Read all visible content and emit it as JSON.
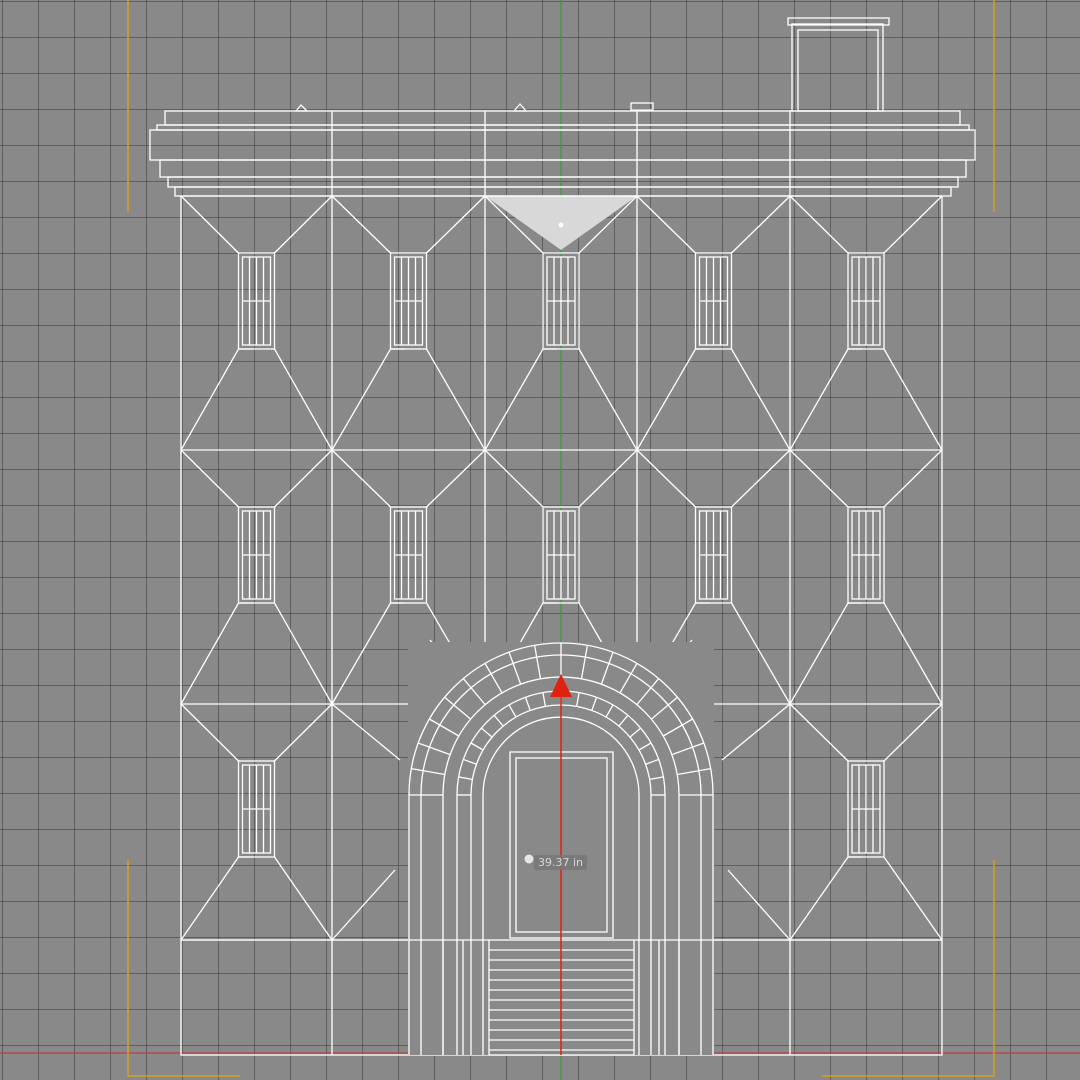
{
  "viewport": {
    "colors": {
      "background": "#898989",
      "grid_line": "#5f5f5f",
      "wireframe": "#ffffff",
      "axis_y": "#3a9a3a",
      "axis_x": "#b84040",
      "frame_guide": "#d4a020",
      "gizmo": "#e02010",
      "selected_face": "#d8d8d8"
    }
  },
  "model": {
    "rows": [
      {
        "id": "top",
        "windows": [
          true,
          true,
          true,
          true,
          true
        ]
      },
      {
        "id": "middle",
        "windows": [
          true,
          true,
          true,
          true,
          true
        ]
      },
      {
        "id": "ground",
        "windows": [
          true,
          false,
          false,
          false,
          true
        ]
      }
    ],
    "selected_bay": 2
  },
  "gizmo": {
    "dimension_label": "39.37 in"
  }
}
